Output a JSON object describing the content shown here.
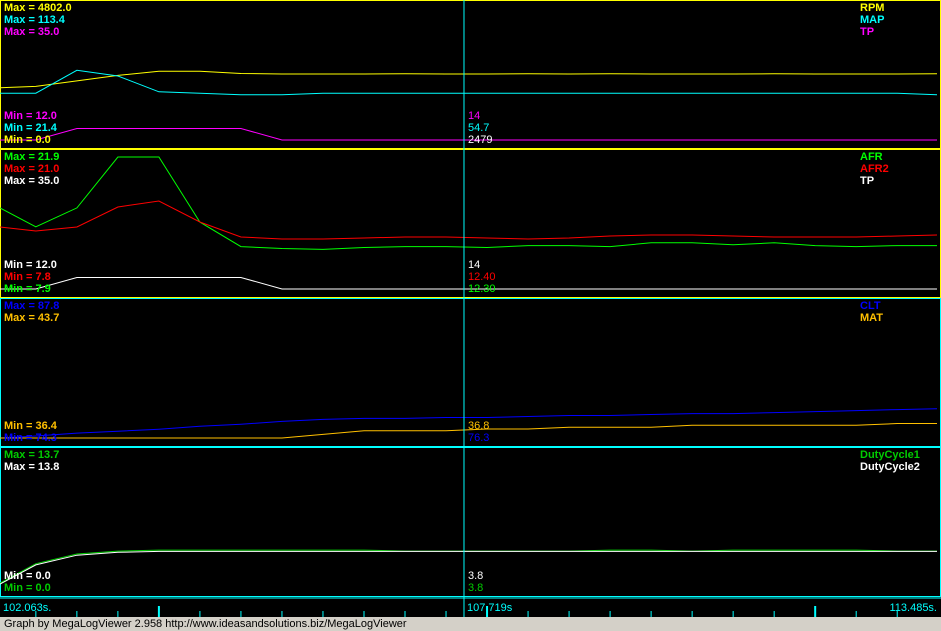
{
  "cursor_time": "107.719s",
  "time_axis": {
    "start": "102.063s.",
    "mid": "107.719s",
    "end": "113.485s."
  },
  "footer": "Graph by MegaLogViewer 2.958 http://www.ideasandsolutions.biz/MegaLogViewer",
  "colors": {
    "rpm": "#ffff00",
    "map": "#00ffff",
    "tp": "#ff00ff",
    "afr": "#00ff00",
    "afr2": "#ff0000",
    "tp2": "#ffffff",
    "clt": "#0000ff",
    "mat": "#ffc000",
    "dc1": "#00cc00",
    "dc2": "#ffffff",
    "cursor": "#00ffff",
    "axis": "#00ffff"
  },
  "panels": [
    {
      "border": "#ffff00",
      "max_labels": [
        {
          "text": "Max = 4802.0",
          "color": "#ffff00"
        },
        {
          "text": "Max = 113.4",
          "color": "#00ffff"
        },
        {
          "text": "Max = 35.0",
          "color": "#ff00ff"
        }
      ],
      "min_labels": [
        {
          "text": "Min = 12.0",
          "color": "#ff00ff"
        },
        {
          "text": "Min = 21.4",
          "color": "#00ffff"
        },
        {
          "text": "Min = 0.0",
          "color": "#ffff00"
        }
      ],
      "legend": [
        {
          "text": "RPM",
          "color": "#ffff00"
        },
        {
          "text": "MAP",
          "color": "#00ffff"
        },
        {
          "text": "TP",
          "color": "#ff00ff"
        }
      ],
      "cursor_values": [
        {
          "text": "14",
          "color": "#ff00ff"
        },
        {
          "text": "54.7",
          "color": "#00ffff"
        },
        {
          "text": "2479",
          "color": "#ffffff"
        }
      ]
    },
    {
      "border": "#ffff00",
      "max_labels": [
        {
          "text": "Max = 21.9",
          "color": "#00ff00"
        },
        {
          "text": "Max = 21.0",
          "color": "#ff0000"
        },
        {
          "text": "Max = 35.0",
          "color": "#ffffff"
        }
      ],
      "min_labels": [
        {
          "text": "Min = 12.0",
          "color": "#ffffff"
        },
        {
          "text": "Min = 7.8",
          "color": "#ff0000"
        },
        {
          "text": "Min = 7.9",
          "color": "#00ff00"
        }
      ],
      "legend": [
        {
          "text": "AFR",
          "color": "#00ff00"
        },
        {
          "text": "AFR2",
          "color": "#ff0000"
        },
        {
          "text": "TP",
          "color": "#ffffff"
        }
      ],
      "cursor_values": [
        {
          "text": "14",
          "color": "#ffffff"
        },
        {
          "text": "12.40",
          "color": "#ff0000"
        },
        {
          "text": "12.30",
          "color": "#00ff00"
        }
      ]
    },
    {
      "border": "#00ffff",
      "max_labels": [
        {
          "text": "Max = 87.8",
          "color": "#0000ff"
        },
        {
          "text": "Max = 43.7",
          "color": "#ffc000"
        }
      ],
      "min_labels": [
        {
          "text": "Min = 36.4",
          "color": "#ffc000"
        },
        {
          "text": "Min = 74.3",
          "color": "#0000ff"
        }
      ],
      "legend": [
        {
          "text": "CLT",
          "color": "#0000ff"
        },
        {
          "text": "MAT",
          "color": "#ffc000"
        }
      ],
      "cursor_values": [
        {
          "text": "36.8",
          "color": "#ffc000"
        },
        {
          "text": "76.3",
          "color": "#0000ff"
        }
      ]
    },
    {
      "border": "#00ffff",
      "max_labels": [
        {
          "text": "Max = 13.7",
          "color": "#00cc00"
        },
        {
          "text": "Max = 13.8",
          "color": "#ffffff"
        }
      ],
      "min_labels": [
        {
          "text": "Min = 0.0",
          "color": "#ffffff"
        },
        {
          "text": "Min = 0.0",
          "color": "#00cc00"
        }
      ],
      "legend": [
        {
          "text": "DutyCycle1",
          "color": "#00cc00"
        },
        {
          "text": "DutyCycle2",
          "color": "#ffffff"
        }
      ],
      "cursor_values": [
        {
          "text": "3.8",
          "color": "#ffffff"
        },
        {
          "text": "3.8",
          "color": "#00cc00"
        }
      ]
    }
  ],
  "chart_data": {
    "type": "line",
    "x_range": [
      102.063,
      113.485
    ],
    "x_unit": "s",
    "cursor_x": 107.719,
    "x": [
      102.063,
      102.5,
      103.0,
      103.5,
      104.0,
      104.5,
      105.0,
      105.5,
      106.0,
      106.5,
      107.0,
      107.5,
      108.0,
      108.5,
      109.0,
      109.5,
      110.0,
      110.5,
      111.0,
      111.5,
      112.0,
      112.5,
      113.0,
      113.485
    ],
    "panels": [
      {
        "series": [
          {
            "name": "RPM",
            "color": "#ffff00",
            "ylim": [
              0,
              4802
            ],
            "values": [
              1900,
              1950,
              2150,
              2350,
              2500,
              2500,
              2420,
              2400,
              2400,
              2400,
              2410,
              2400,
              2400,
              2410,
              2400,
              2410,
              2400,
              2400,
              2400,
              2410,
              2400,
              2400,
              2400,
              2410
            ]
          },
          {
            "name": "MAP",
            "color": "#00ffff",
            "ylim": [
              21.4,
              113.4
            ],
            "values": [
              54,
              54,
              70,
              66,
              55,
              54,
              53,
              53,
              54,
              54,
              54,
              54,
              54,
              54,
              54,
              54,
              54,
              54,
              54,
              54,
              54,
              54,
              54,
              53
            ]
          },
          {
            "name": "TP",
            "color": "#ff00ff",
            "ylim": [
              12,
              35
            ],
            "values": [
              12,
              12,
              14,
              14,
              14,
              14,
              14,
              12,
              12,
              12,
              12,
              12,
              12,
              12,
              12,
              12,
              12,
              12,
              12,
              12,
              12,
              12,
              12,
              12
            ]
          }
        ]
      },
      {
        "series": [
          {
            "name": "AFR",
            "color": "#00ff00",
            "ylim": [
              7.9,
              21.9
            ],
            "values": [
              16.5,
              14.5,
              16.5,
              21.9,
              21.9,
              15.0,
              12.4,
              12.2,
              12.1,
              12.3,
              12.4,
              12.4,
              12.3,
              12.5,
              12.5,
              12.4,
              12.8,
              12.8,
              12.6,
              12.8,
              12.5,
              12.4,
              12.5,
              12.5
            ]
          },
          {
            "name": "AFR2",
            "color": "#ff0000",
            "ylim": [
              7.8,
              21.0
            ],
            "values": [
              14.0,
              13.6,
              14.0,
              16.0,
              16.6,
              14.5,
              13.0,
              12.8,
              12.8,
              12.9,
              13.0,
              13.0,
              12.9,
              12.8,
              12.9,
              13.1,
              13.2,
              13.2,
              13.1,
              13.0,
              13.0,
              13.0,
              13.1,
              13.2
            ]
          },
          {
            "name": "TP",
            "color": "#ffffff",
            "ylim": [
              12,
              35
            ],
            "values": [
              12,
              12,
              14,
              14,
              14,
              14,
              14,
              12,
              12,
              12,
              12,
              12,
              12,
              12,
              12,
              12,
              12,
              12,
              12,
              12,
              12,
              12,
              12,
              12
            ]
          }
        ]
      },
      {
        "series": [
          {
            "name": "CLT",
            "color": "#0000ff",
            "ylim": [
              74.3,
              87.8
            ],
            "values": [
              74.3,
              74.5,
              74.8,
              75.0,
              75.2,
              75.5,
              75.7,
              76.0,
              76.2,
              76.3,
              76.3,
              76.4,
              76.4,
              76.5,
              76.6,
              76.6,
              76.7,
              76.8,
              76.8,
              76.9,
              77.0,
              77.1,
              77.2,
              77.3
            ]
          },
          {
            "name": "MAT",
            "color": "#ffc000",
            "ylim": [
              36.4,
              43.7
            ],
            "values": [
              36.4,
              36.4,
              36.4,
              36.4,
              36.4,
              36.4,
              36.4,
              36.4,
              36.6,
              36.8,
              36.8,
              36.8,
              36.9,
              36.9,
              37.0,
              37.0,
              37.0,
              37.1,
              37.1,
              37.1,
              37.1,
              37.1,
              37.2,
              37.2
            ]
          }
        ]
      },
      {
        "series": [
          {
            "name": "DutyCycle1",
            "color": "#00cc00",
            "ylim": [
              0,
              13.7
            ],
            "values": [
              0.5,
              2.5,
              3.5,
              3.8,
              3.9,
              3.9,
              3.9,
              3.9,
              3.9,
              3.9,
              3.8,
              3.8,
              3.8,
              3.8,
              3.8,
              3.9,
              3.9,
              3.8,
              3.9,
              3.9,
              3.9,
              3.9,
              3.8,
              3.8
            ]
          },
          {
            "name": "DutyCycle2",
            "color": "#ffffff",
            "ylim": [
              0,
              13.8
            ],
            "values": [
              0.4,
              2.4,
              3.4,
              3.7,
              3.8,
              3.8,
              3.8,
              3.8,
              3.8,
              3.8,
              3.8,
              3.8,
              3.8,
              3.8,
              3.8,
              3.8,
              3.8,
              3.8,
              3.8,
              3.8,
              3.8,
              3.8,
              3.8,
              3.8
            ]
          }
        ]
      }
    ]
  }
}
